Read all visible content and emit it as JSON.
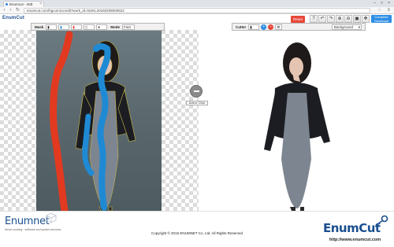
{
  "browser": {
    "tab_title": "Enumcut - ntdt",
    "tab_close": "×",
    "url": "enumcut.com/hgcomiccredit?work_id=NUKL20160208000622",
    "nav_back": "‹",
    "nav_forward": "›",
    "nav_reload": "↻"
  },
  "app": {
    "logo_enum": "Enum",
    "logo_cut": "Cut",
    "reset_label": "Reset",
    "complete_label": "Complete\nDownload",
    "colors": {
      "accent": "#2d8ee3",
      "reset": "#e8483a",
      "brand": "#1a4f8f",
      "marker_red": "#e23a20",
      "marker_blue": "#1f8ad3"
    }
  },
  "mask_toolbar": {
    "label": "Mask",
    "mode_label": "Mode",
    "mode_value": "Fast",
    "tools": [
      "-",
      "-",
      "-",
      "-",
      "-"
    ]
  },
  "cutter_toolbar": {
    "label": "Cutter",
    "background_value": "Background"
  },
  "active_click": {
    "label": "Active Click"
  },
  "footer": {
    "enumnet_logo": "Enumnet",
    "enumnet_tagline": "Smart working · software and system services",
    "copyright": "Copyright © 2015 ENUMNET Co. Ltd. All Rights Reserved",
    "enumcut_logo": "EnumCut",
    "enumcut_url": "http://www.enumcut.com"
  }
}
